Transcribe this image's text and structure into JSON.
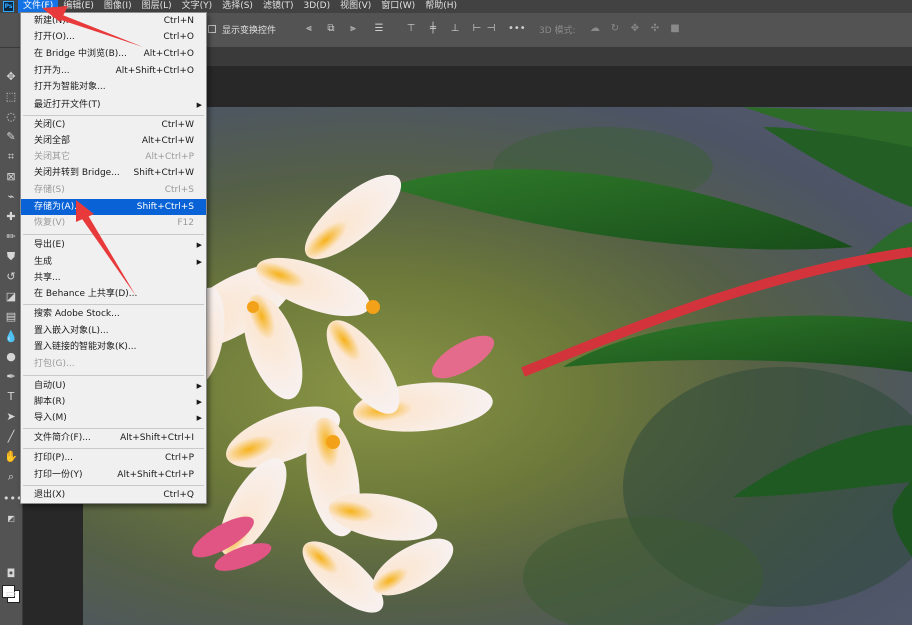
{
  "menubar": {
    "logo": "Ps",
    "items": [
      "文件(F)",
      "编辑(E)",
      "图像(I)",
      "图层(L)",
      "文字(Y)",
      "选择(S)",
      "滤镜(T)",
      "3D(D)",
      "视图(V)",
      "窗口(W)",
      "帮助(H)"
    ]
  },
  "options": {
    "transform_label": "显示变换控件",
    "mode_3d_label": "3D 模式:"
  },
  "file_menu": {
    "items": [
      {
        "label": "新建(N)...",
        "shortcut": "Ctrl+N"
      },
      {
        "label": "打开(O)...",
        "shortcut": "Ctrl+O"
      },
      {
        "label": "在 Bridge 中浏览(B)...",
        "shortcut": "Alt+Ctrl+O"
      },
      {
        "label": "打开为...",
        "shortcut": "Alt+Shift+Ctrl+O"
      },
      {
        "label": "打开为智能对象...",
        "shortcut": ""
      },
      {
        "label": "最近打开文件(T)",
        "shortcut": ""
      },
      {
        "label": "关闭(C)",
        "shortcut": "Ctrl+W"
      },
      {
        "label": "关闭全部",
        "shortcut": "Alt+Ctrl+W"
      },
      {
        "label": "关闭其它",
        "shortcut": "Alt+Ctrl+P"
      },
      {
        "label": "关闭并转到 Bridge...",
        "shortcut": "Shift+Ctrl+W"
      },
      {
        "label": "存储(S)",
        "shortcut": "Ctrl+S"
      },
      {
        "label": "存储为(A)...",
        "shortcut": "Shift+Ctrl+S"
      },
      {
        "label": "恢复(V)",
        "shortcut": "F12"
      },
      {
        "label": "导出(E)",
        "shortcut": ""
      },
      {
        "label": "生成",
        "shortcut": ""
      },
      {
        "label": "共享...",
        "shortcut": ""
      },
      {
        "label": "在 Behance 上共享(D)...",
        "shortcut": ""
      },
      {
        "label": "搜索 Adobe Stock...",
        "shortcut": ""
      },
      {
        "label": "置入嵌入对象(L)...",
        "shortcut": ""
      },
      {
        "label": "置入链接的智能对象(K)...",
        "shortcut": ""
      },
      {
        "label": "打包(G)...",
        "shortcut": ""
      },
      {
        "label": "自动(U)",
        "shortcut": ""
      },
      {
        "label": "脚本(R)",
        "shortcut": ""
      },
      {
        "label": "导入(M)",
        "shortcut": ""
      },
      {
        "label": "文件简介(F)...",
        "shortcut": "Alt+Shift+Ctrl+I"
      },
      {
        "label": "打印(P)...",
        "shortcut": "Ctrl+P"
      },
      {
        "label": "打印一份(Y)",
        "shortcut": "Alt+Shift+Ctrl+P"
      },
      {
        "label": "退出(X)",
        "shortcut": "Ctrl+Q"
      }
    ]
  },
  "colors": {
    "menu_highlight": "#0963d6",
    "menubar_active": "#1473e6",
    "annotation": "#e83a3a"
  }
}
